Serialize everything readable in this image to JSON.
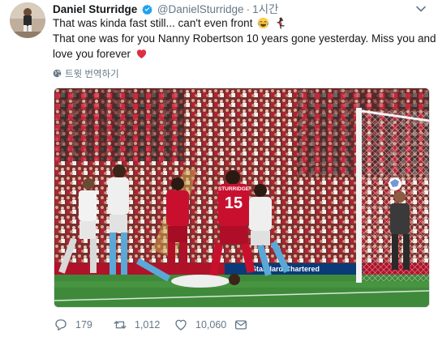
{
  "tweet": {
    "author_name": "Daniel Sturridge",
    "author_handle": "@DanielSturridge",
    "separator": "·",
    "timestamp": "1시간",
    "text_line1": "That was kinda fast still... can't even front",
    "text_line2": "That one was for you Nanny Robertson 10 years gone yesterday. Miss you and",
    "text_line3": "love you forever",
    "translate_label": "트윗 번역하기",
    "media_shirt_number": "15",
    "media_shirt_name": "STURRIDGE",
    "media_board_text": "Standard Chartered"
  },
  "actions": {
    "replies": "179",
    "retweets": "1,012",
    "likes": "10,060"
  },
  "colors": {
    "text": "#14171a",
    "secondary": "#657786",
    "verified": "#1da1f2",
    "heart_emoji": "#e0245e",
    "liverpool_red": "#c8102e",
    "pitch_green": "#3f8a3a"
  },
  "icons": [
    "verified-badge-icon",
    "caret-down-icon",
    "joy-emoji-icon",
    "dancer-emoji-icon",
    "heart-emoji-icon",
    "globe-icon",
    "reply-icon",
    "retweet-icon",
    "like-icon",
    "direct-message-icon"
  ]
}
